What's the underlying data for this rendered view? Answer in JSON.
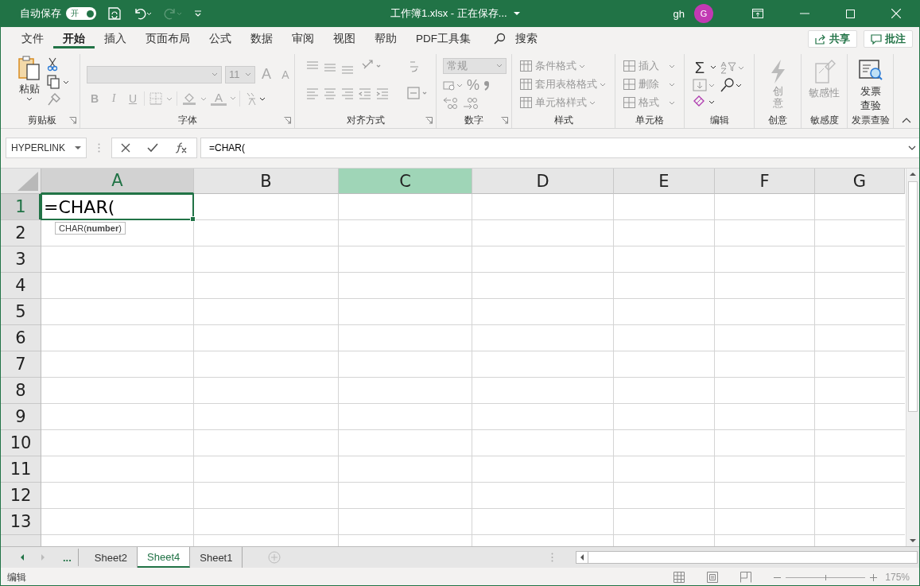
{
  "title_bar": {
    "autosave_label": "自动保存",
    "autosave_toggle": {
      "label": "开",
      "on": true
    },
    "title": "工作簿1.xlsx  -  正在保存...",
    "user": "gh",
    "avatar": "G"
  },
  "menu_tabs": [
    {
      "label": "文件",
      "selected": false
    },
    {
      "label": "开始",
      "selected": true
    },
    {
      "label": "插入",
      "selected": false
    },
    {
      "label": "页面布局",
      "selected": false
    },
    {
      "label": "公式",
      "selected": false
    },
    {
      "label": "数据",
      "selected": false
    },
    {
      "label": "审阅",
      "selected": false
    },
    {
      "label": "视图",
      "selected": false
    },
    {
      "label": "帮助",
      "selected": false
    },
    {
      "label": "PDF工具集",
      "selected": false
    }
  ],
  "search": "搜索",
  "share_button": "共享",
  "comments_button": "批注",
  "ribbon": {
    "clipboard": {
      "label": "剪贴板",
      "paste": "粘贴",
      "disabled": false
    },
    "font": {
      "label": "字体",
      "size": "11",
      "grow": "A",
      "shrink": "A",
      "bold": "B",
      "italic": "I",
      "underline": "U",
      "font_color": "A",
      "disabled": true
    },
    "alignment": {
      "label": "对齐方式",
      "disabled": true
    },
    "number": {
      "label": "数字",
      "format": "常规",
      "percent": "%",
      "disabled": true
    },
    "styles": {
      "label": "样式",
      "items": [
        "条件格式",
        "套用表格格式",
        "单元格样式"
      ],
      "disabled": true
    },
    "cells": {
      "label": "单元格",
      "items": [
        "插入",
        "删除",
        "格式"
      ],
      "disabled": true
    },
    "editing": {
      "label": "编辑",
      "sum": "Σ",
      "disabled": false
    },
    "ideas": {
      "label": "创意",
      "button": "创意",
      "disabled": true
    },
    "sensitivity": {
      "label": "敏感度",
      "button": "敏感性",
      "disabled": true
    },
    "invoice": {
      "label": "发票查验",
      "button": "发票查验",
      "disabled": false
    }
  },
  "formula_bar": {
    "name_box": "HYPERLINK",
    "formula": "=CHAR("
  },
  "columns": [
    {
      "label": "A",
      "selected": true,
      "highlighted": false
    },
    {
      "label": "B",
      "selected": false,
      "highlighted": false
    },
    {
      "label": "C",
      "selected": false,
      "highlighted": true
    },
    {
      "label": "D",
      "selected": false,
      "highlighted": false
    },
    {
      "label": "E",
      "selected": false,
      "highlighted": false
    },
    {
      "label": "F",
      "selected": false,
      "highlighted": false
    },
    {
      "label": "G",
      "selected": false,
      "highlighted": false
    }
  ],
  "rows": [
    {
      "label": "1",
      "selected": true
    },
    {
      "label": "2",
      "selected": false
    },
    {
      "label": "3",
      "selected": false
    },
    {
      "label": "4",
      "selected": false
    },
    {
      "label": "5",
      "selected": false
    },
    {
      "label": "6",
      "selected": false
    },
    {
      "label": "7",
      "selected": false
    },
    {
      "label": "8",
      "selected": false
    },
    {
      "label": "9",
      "selected": false
    },
    {
      "label": "10",
      "selected": false
    },
    {
      "label": "11",
      "selected": false
    },
    {
      "label": "12",
      "selected": false
    },
    {
      "label": "13",
      "selected": false
    }
  ],
  "active_cell": {
    "value": "=CHAR(",
    "tooltip": "CHAR(**number**)"
  },
  "sheet_tabs": {
    "more": "...",
    "tabs": [
      {
        "label": "Sheet2",
        "selected": false
      },
      {
        "label": "Sheet4",
        "selected": true
      },
      {
        "label": "Sheet1",
        "selected": false
      }
    ]
  },
  "status_bar": {
    "mode": "编辑",
    "zoom_slider": {
      "level": 0.5
    },
    "zoom": "175%"
  }
}
